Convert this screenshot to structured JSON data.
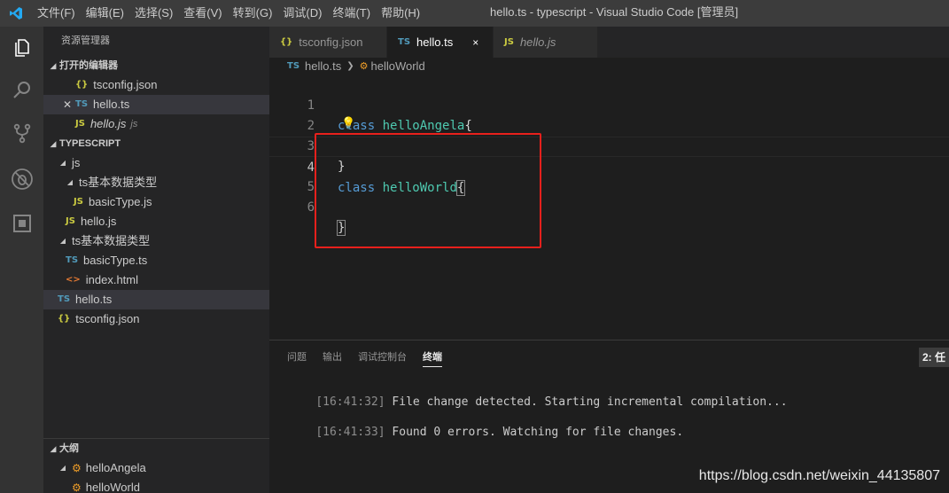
{
  "titlebar": {
    "menu": [
      "文件(F)",
      "编辑(E)",
      "选择(S)",
      "查看(V)",
      "转到(G)",
      "调试(D)",
      "终端(T)",
      "帮助(H)"
    ],
    "title": "hello.ts - typescript - Visual Studio Code [管理员]"
  },
  "sidebar": {
    "title": "资源管理器",
    "open_editors": {
      "header": "打开的编辑器",
      "items": [
        {
          "icon": "{}",
          "name": "tsconfig.json"
        },
        {
          "icon": "TS",
          "name": "hello.ts"
        },
        {
          "icon": "JS",
          "name": "hello.js",
          "dir": "js"
        }
      ]
    },
    "workspace": {
      "header": "TYPESCRIPT",
      "items": [
        {
          "icon": "",
          "name": "js"
        },
        {
          "icon": "",
          "name": "ts基本数据类型"
        },
        {
          "icon": "JS",
          "name": "basicType.js"
        },
        {
          "icon": "JS",
          "name": "hello.js"
        },
        {
          "icon": "",
          "name": "ts基本数据类型"
        },
        {
          "icon": "TS",
          "name": "basicType.ts"
        },
        {
          "icon": "<>",
          "name": "index.html"
        },
        {
          "icon": "TS",
          "name": "hello.ts"
        },
        {
          "icon": "{}",
          "name": "tsconfig.json"
        }
      ]
    },
    "outline": {
      "header": "大纲",
      "items": [
        {
          "name": "helloAngela"
        },
        {
          "name": "helloWorld"
        }
      ]
    }
  },
  "tabs": [
    {
      "icon": "{}",
      "label": "tsconfig.json"
    },
    {
      "icon": "TS",
      "label": "hello.ts",
      "close": "×"
    },
    {
      "icon": "JS",
      "label": "hello.js"
    }
  ],
  "breadcrumb": {
    "file_icon": "TS",
    "file": "hello.ts",
    "symbol": "helloWorld"
  },
  "editor": {
    "lines": [
      {
        "n": "1",
        "kw": "class",
        "name": "helloAngela",
        "brace": "{"
      },
      {
        "n": "2",
        "kw": "",
        "name": "",
        "brace": ""
      },
      {
        "n": "3",
        "kw": "",
        "name": "",
        "brace": "}"
      },
      {
        "n": "4",
        "kw": "class",
        "name": "helloWorld",
        "brace": "{"
      },
      {
        "n": "5",
        "kw": "",
        "name": "",
        "brace": ""
      },
      {
        "n": "6",
        "kw": "",
        "name": "",
        "brace": "}"
      }
    ]
  },
  "panel": {
    "tabs": [
      "问题",
      "输出",
      "调试控制台",
      "终端"
    ],
    "terminal_select": "2: 任",
    "lines": [
      {
        "time": "[16:41:32]",
        "text": " File change detected. Starting incremental compilation..."
      },
      {
        "time": "[16:41:33]",
        "text": " Found 0 errors. Watching for file changes."
      }
    ]
  },
  "watermark": "https://blog.csdn.net/weixin_44135807",
  "colors": {
    "accent": "#007acc",
    "keyword": "#569cd6",
    "class_name": "#4ec9b0",
    "annotation_box": "#e8201c"
  }
}
